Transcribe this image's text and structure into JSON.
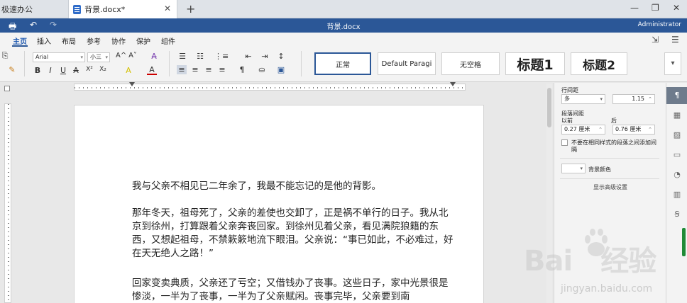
{
  "tabs": {
    "inactive_label": "极速办公",
    "active_label": "背景.docx*",
    "close_glyph": "✕",
    "new_glyph": "+"
  },
  "window": {
    "min": "—",
    "restore": "❐",
    "close": "✕"
  },
  "titlebar": {
    "doc_title": "背景.docx",
    "user": "Administrator"
  },
  "menu": {
    "items": [
      "主页",
      "插入",
      "布局",
      "参考",
      "协作",
      "保护",
      "组件"
    ]
  },
  "toolbar": {
    "font_name": "Arial",
    "font_size": "小三",
    "bold": "B",
    "italic": "I",
    "underline": "U",
    "strike": "A",
    "superscript": "X²",
    "subscript": "X₂",
    "grow": "A^",
    "shrink": "A˅",
    "highlight": "A",
    "color": "A",
    "pilcrow": "¶"
  },
  "styles": {
    "items": [
      {
        "label": "正常",
        "selected": true
      },
      {
        "label": "Default Paragi",
        "selected": false
      },
      {
        "label": "无空格",
        "selected": false
      },
      {
        "label": "标题1",
        "selected": false
      },
      {
        "label": "标题2",
        "selected": false
      }
    ],
    "more": "▾"
  },
  "document": {
    "paragraphs": [
      "我与父亲不相见已二年余了，我最不能忘记的是他的背影。",
      "那年冬天，祖母死了，父亲的差使也交卸了，正是祸不单行的日子。我从北京到徐州，打算跟着父亲奔丧回家。到徐州见着父亲，看见满院狼籍的东西，又想起祖母，不禁簌簌地流下眼泪。父亲说：“事已如此，不必难过，好在天无绝人之路！”",
      "回家变卖典质，父亲还了亏空；又借钱办了丧事。这些日子，家中光景很是惨淡，一半为了丧事，一半为了父亲赋闲。丧事完毕，父亲要到南"
    ]
  },
  "panel": {
    "line_spacing_label": "行间距",
    "line_spacing_mode": "多",
    "line_spacing_value": "1.15",
    "para_spacing_label": "段落间距",
    "before_label": "以前",
    "after_label": "后",
    "before_value": "0.27 厘米",
    "after_value": "0.76 厘米",
    "checkbox_text": "不要在相同样式的段落之间添加间隔",
    "bg_color_label": "背景颜色",
    "advanced_link": "显示高级设置"
  },
  "watermark": {
    "brand": "Bai",
    "brand2": "经验",
    "url": "jingyan.baidu.com"
  },
  "colors": {
    "brand_blue": "#2b5797",
    "accent_green": "#1f8a36"
  }
}
